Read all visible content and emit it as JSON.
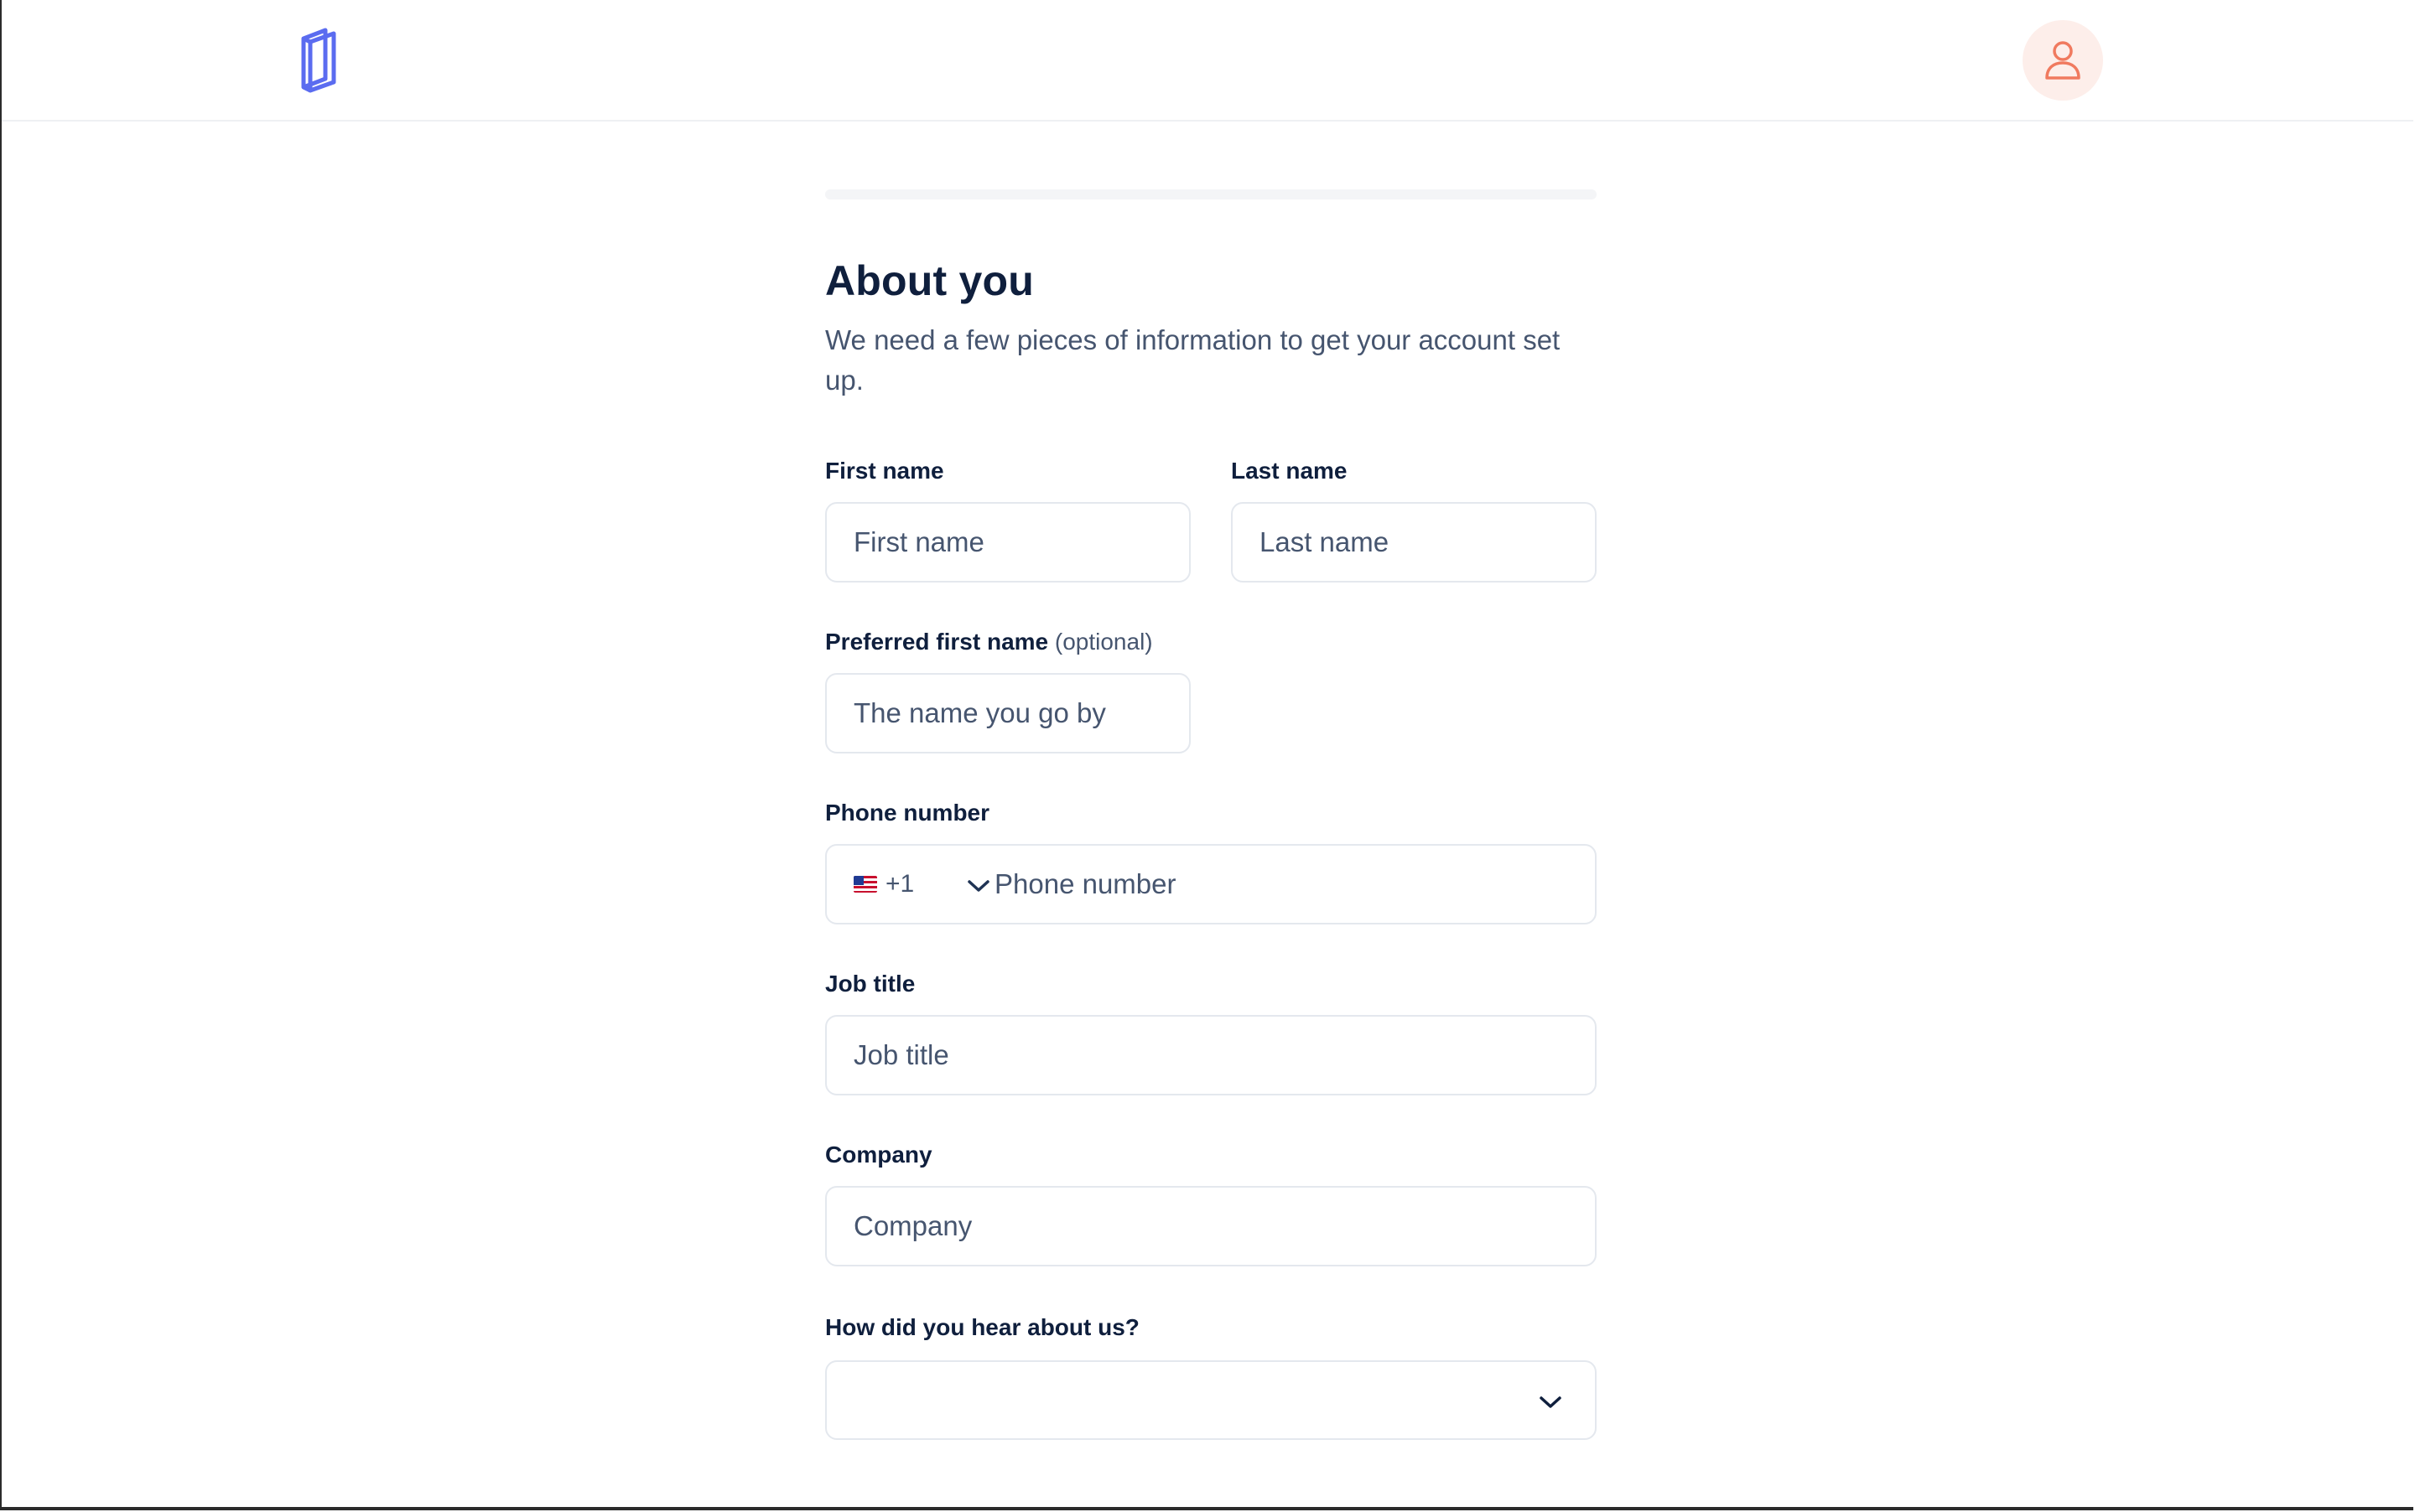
{
  "header": {
    "logo_icon": "book-logo-icon",
    "profile_icon": "user-icon"
  },
  "colors": {
    "brand": "#5b6cf0",
    "accent": "#f07a5f",
    "avatar_bg": "#fdeeea",
    "text_dark": "#0f1f3d",
    "text_muted": "#46556f",
    "border": "#e4e8ee"
  },
  "progress": {
    "fraction": 0
  },
  "form": {
    "title": "About you",
    "subtitle": "We need a few pieces of information to get your account set up.",
    "first_name": {
      "label": "First name",
      "placeholder": "First name"
    },
    "last_name": {
      "label": "Last name",
      "placeholder": "Last name"
    },
    "preferred_name": {
      "label": "Preferred first name",
      "optional": "(optional)",
      "placeholder": "The name you go by"
    },
    "phone": {
      "label": "Phone number",
      "country_code": "+1",
      "country_flag": "us-flag-icon",
      "placeholder": "Phone number"
    },
    "job_title": {
      "label": "Job title",
      "placeholder": "Job title"
    },
    "company": {
      "label": "Company",
      "placeholder": "Company"
    },
    "referral": {
      "label": "How did you hear about us?",
      "value": ""
    }
  }
}
